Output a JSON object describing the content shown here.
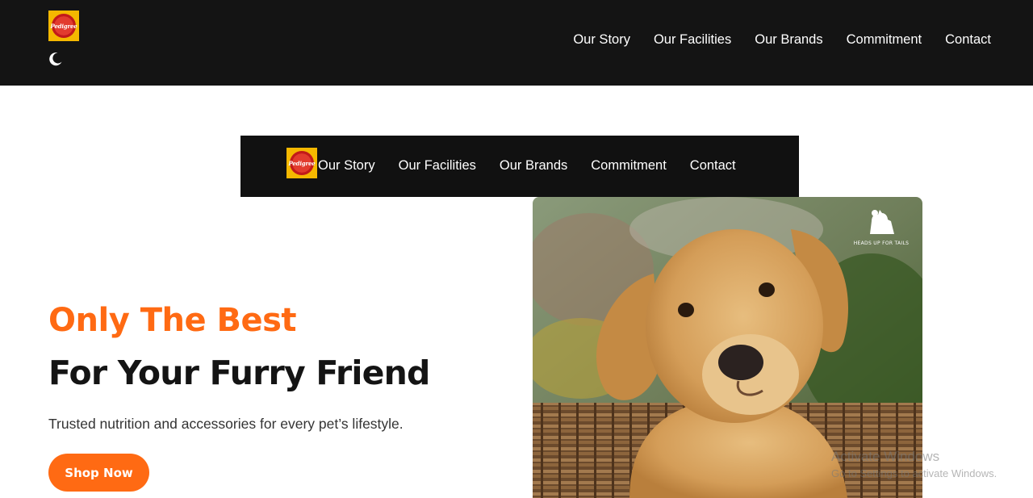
{
  "brand": {
    "logo_text": "Pedigree"
  },
  "header": {
    "nav": [
      "Our Story",
      "Our Facilities",
      "Our Brands",
      "Commitment",
      "Contact"
    ],
    "theme_toggle_icon": "moon-icon"
  },
  "subheader": {
    "nav": [
      "Our Story",
      "Our Facilities",
      "Our Brands",
      "Commitment",
      "Contact"
    ]
  },
  "hero": {
    "title_line_1": "Only The Best",
    "title_line_2": "For Your Furry Friend",
    "subtitle": "Trusted nutrition and accessories for every pet’s lifestyle.",
    "cta_label": "Shop Now",
    "image_watermark": "HEADS UP FOR TAILS"
  },
  "system_overlay": {
    "line_1": "Activate Windows",
    "line_2": "Go to Settings to activate Windows."
  },
  "colors": {
    "accent": "#ff6a13",
    "header_bg": "#141414",
    "subnav_bg": "#111111",
    "logo_bg": "#f5b800"
  }
}
